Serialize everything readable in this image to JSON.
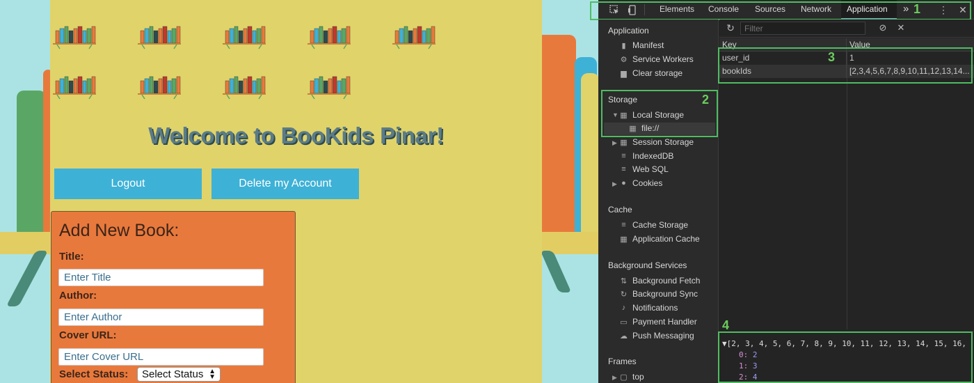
{
  "page": {
    "welcome": "Welcome to BooKids Pinar!",
    "logout_label": "Logout",
    "delete_label": "Delete my Account"
  },
  "form": {
    "title": "Add New Book:",
    "title_label": "Title:",
    "title_placeholder": "Enter Title",
    "author_label": "Author:",
    "author_placeholder": "Enter Author",
    "cover_label": "Cover URL:",
    "cover_placeholder": "Enter Cover URL",
    "status_label": "Select Status:",
    "status_value": "Select Status"
  },
  "devtools": {
    "tabs": [
      "Elements",
      "Console",
      "Sources",
      "Network",
      "Application"
    ],
    "active_tab": "Application",
    "more": "»",
    "annotations": [
      "1",
      "2",
      "3",
      "4"
    ],
    "sidebar": {
      "application_head": "Application",
      "application_items": [
        "Manifest",
        "Service Workers",
        "Clear storage"
      ],
      "storage_head": "Storage",
      "local_storage": "Local Storage",
      "local_storage_child": "file://",
      "storage_items": [
        "Session Storage",
        "IndexedDB",
        "Web SQL",
        "Cookies"
      ],
      "cache_head": "Cache",
      "cache_items": [
        "Cache Storage",
        "Application Cache"
      ],
      "bg_head": "Background Services",
      "bg_items": [
        "Background Fetch",
        "Background Sync",
        "Notifications",
        "Payment Handler",
        "Push Messaging"
      ],
      "frames_head": "Frames",
      "frames_items": [
        "top"
      ]
    },
    "filter_placeholder": "Filter",
    "table": {
      "headers": [
        "Key",
        "Value"
      ],
      "rows": [
        {
          "key": "user_id",
          "value": "1"
        },
        {
          "key": "bookIds",
          "value": "[2,3,4,5,6,7,8,9,10,11,12,13,14..."
        }
      ]
    },
    "preview": {
      "summary": "[2, 3, 4, 5, 6, 7, 8, 9, 10, 11, 12, 13, 14, 15, 16,",
      "items": [
        {
          "index": "0:",
          "value": "2"
        },
        {
          "index": "1:",
          "value": "3"
        },
        {
          "index": "2:",
          "value": "4"
        }
      ]
    },
    "colors": {
      "highlight": "#4fbd62",
      "accent_tab": "#7a9fd1"
    }
  },
  "colors": {
    "background": "#abe3e4",
    "panel": "#e0d36a",
    "button": "#3eb1d6",
    "form_card": "#e8793c"
  }
}
